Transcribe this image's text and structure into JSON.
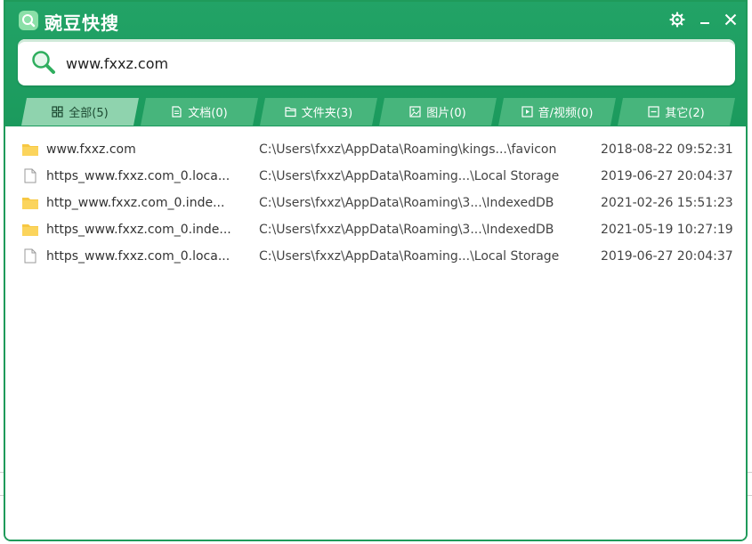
{
  "app": {
    "title": "豌豆快搜"
  },
  "search": {
    "value": "www.fxxz.com"
  },
  "tabs": [
    {
      "label": "全部(5)",
      "icon": "grid-icon",
      "active": true
    },
    {
      "label": "文档(0)",
      "icon": "document-icon",
      "active": false
    },
    {
      "label": "文件夹(3)",
      "icon": "folder-icon",
      "active": false
    },
    {
      "label": "图片(0)",
      "icon": "image-icon",
      "active": false
    },
    {
      "label": "音/视频(0)",
      "icon": "media-icon",
      "active": false
    },
    {
      "label": "其它(2)",
      "icon": "other-icon",
      "active": false
    }
  ],
  "results": [
    {
      "name": "www.fxxz.com",
      "path": "C:\\Users\\fxxz\\AppData\\Roaming\\kings...\\favicon",
      "time": "2018-08-22 09:52:31",
      "type": "folder"
    },
    {
      "name": "https_www.fxxz.com_0.loca...",
      "path": "C:\\Users\\fxxz\\AppData\\Roaming...\\Local Storage",
      "time": "2019-06-27 20:04:37",
      "type": "file"
    },
    {
      "name": "http_www.fxxz.com_0.inde...",
      "path": "C:\\Users\\fxxz\\AppData\\Roaming\\3...\\IndexedDB",
      "time": "2021-02-26 15:51:23",
      "type": "folder"
    },
    {
      "name": "https_www.fxxz.com_0.inde...",
      "path": "C:\\Users\\fxxz\\AppData\\Roaming\\3...\\IndexedDB",
      "time": "2021-05-19 10:27:19",
      "type": "folder"
    },
    {
      "name": "https_www.fxxz.com_0.loca...",
      "path": "C:\\Users\\fxxz\\AppData\\Roaming...\\Local Storage",
      "time": "2019-06-27 20:04:37",
      "type": "file"
    }
  ],
  "colors": {
    "header_green": "#1f9a5a",
    "tab_green": "#47b57c",
    "tab_active": "#8fd3ae",
    "folder_yellow": "#f7c843"
  }
}
